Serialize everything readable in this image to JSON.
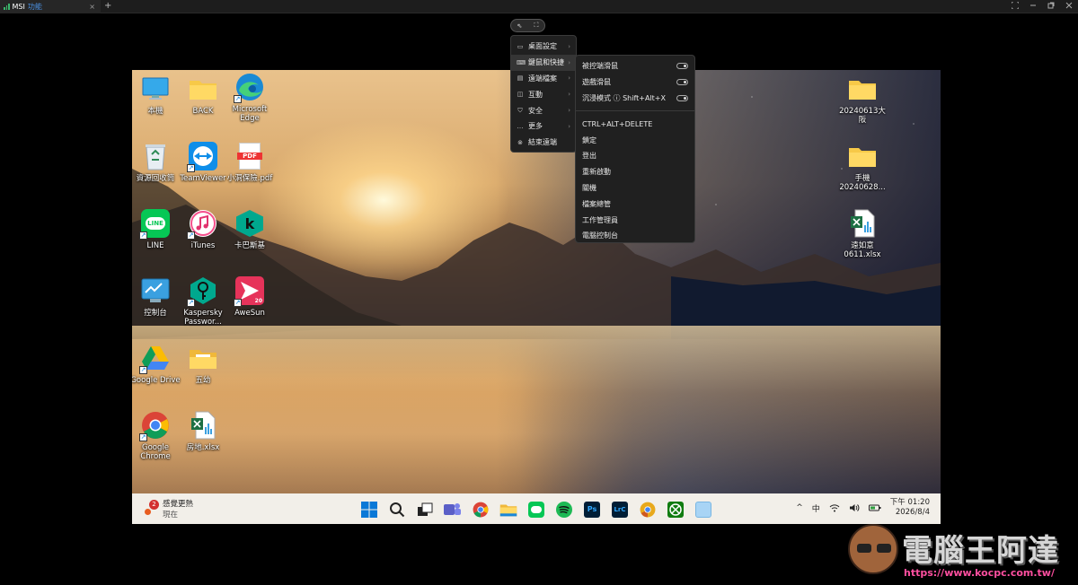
{
  "window": {
    "tab_name": "MSI",
    "tab_sub": "功能",
    "tab_close": "×",
    "new_tab": "+"
  },
  "desktop_icons_left": [
    {
      "label": "本機"
    },
    {
      "label": "BACK"
    },
    {
      "label": "Microsoft Edge"
    },
    {
      "label": "資源回收筒"
    },
    {
      "label": "TeamViewer"
    },
    {
      "label": "小洞保險.pdf"
    },
    {
      "label": "LINE"
    },
    {
      "label": "iTunes"
    },
    {
      "label": "卡巴斯基"
    },
    {
      "label": "控制台"
    },
    {
      "label": "Kaspersky Passwor..."
    },
    {
      "label": "AweSun"
    },
    {
      "label": "Google Drive"
    },
    {
      "label": "五幼"
    },
    {
      "label": "Google Chrome"
    },
    {
      "label": "房地.xlsx"
    }
  ],
  "desktop_icons_right": [
    {
      "label": "20240613大阪"
    },
    {
      "label": "手機 20240628..."
    },
    {
      "label": "遠如意 0611.xlsx"
    }
  ],
  "icon_glyphs": {
    "pdf": "PDF",
    "line": "LINE",
    "kaspersky": "k",
    "awesun": "20",
    "shortcut": "↗"
  },
  "toolbar": {
    "pointer": "⇖",
    "fullscreen": "⛶"
  },
  "menu_main": [
    {
      "icon": "▭",
      "label": "桌面設定"
    },
    {
      "icon": "⌨",
      "label": "鍵鼠和快捷"
    },
    {
      "icon": "▤",
      "label": "遠端檔案"
    },
    {
      "icon": "◫",
      "label": "互動"
    },
    {
      "icon": "⛉",
      "label": "安全"
    },
    {
      "icon": "…",
      "label": "更多"
    },
    {
      "icon": "⊗",
      "label": "結束遠端"
    }
  ],
  "menu_chevron": "›",
  "menu_sub": {
    "toggles": [
      {
        "label": "被控端滑鼠"
      },
      {
        "label": "遊戲滑鼠"
      },
      {
        "label": "沉浸模式 ⓘ Shift+Alt+X"
      }
    ],
    "actions": [
      {
        "label": "CTRL+ALT+DELETE"
      },
      {
        "label": "鎖定"
      },
      {
        "label": "登出"
      },
      {
        "label": "重新啟動"
      },
      {
        "label": "關機"
      },
      {
        "label": "檔案總管"
      },
      {
        "label": "工作管理員"
      },
      {
        "label": "電腦控制台"
      }
    ]
  },
  "taskbar": {
    "weather_badge": "2",
    "weather_title": "感覺更熱",
    "weather_sub": "現在",
    "apps": {
      "photoshop": "Ps",
      "lightroom": "LrC"
    },
    "tray_chevron": "^",
    "ime": "中",
    "time": "下午 01:20",
    "date": "2026/8/4"
  },
  "watermark": {
    "title": "電腦王阿達",
    "url": "https://www.kocpc.com.tw/"
  },
  "colors": {
    "accent_blue": "#0078d4",
    "line_green": "#06c755",
    "spotify_green": "#1db954",
    "watermark_pink": "#ff4fa0"
  }
}
